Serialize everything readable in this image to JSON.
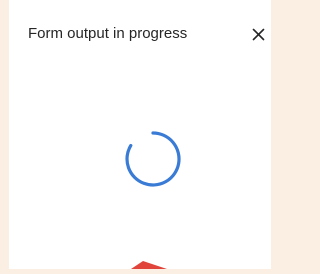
{
  "dialog": {
    "title": "Form output in progress",
    "close_icon": "close-icon",
    "close_glyph": "✕"
  },
  "spinner": {
    "icon": "loading-spinner-icon",
    "color": "#3a7bd5"
  },
  "cursor": {
    "icon": "mouse-pointer-icon",
    "color": "#e0443a"
  },
  "colors": {
    "background": "#fbeee2",
    "dialog": "#ffffff",
    "title_text": "#262626"
  }
}
